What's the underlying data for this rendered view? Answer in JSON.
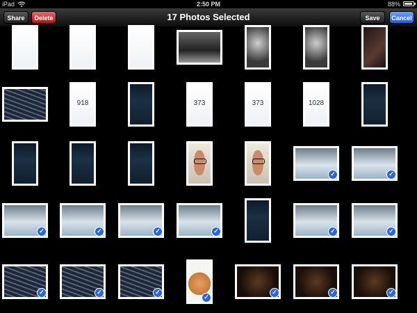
{
  "status": {
    "device": "iPad",
    "time": "2:50 PM",
    "battery": "88%",
    "battery_level": 0.88
  },
  "nav": {
    "share": "Share",
    "delete": "Delete",
    "title": "17 Photos Selected",
    "save": "Save",
    "cancel": "Cancel"
  },
  "photos": [
    {
      "kind": "screenshot-form",
      "sel": false
    },
    {
      "kind": "screenshot-profile",
      "sel": false
    },
    {
      "kind": "screenshot-web",
      "sel": false
    },
    {
      "kind": "photo-laptop",
      "sel": false
    },
    {
      "kind": "photo-glasses",
      "sel": false
    },
    {
      "kind": "photo-glasses",
      "sel": false
    },
    {
      "kind": "photo-dark",
      "sel": false
    },
    {
      "kind": "photo-keyboard",
      "sel": false
    },
    {
      "kind": "screenshot-number",
      "number": "918",
      "sel": false
    },
    {
      "kind": "screenshot-speed",
      "sel": false
    },
    {
      "kind": "screenshot-number",
      "number": "373",
      "sel": false
    },
    {
      "kind": "screenshot-number",
      "number": "373",
      "sel": false
    },
    {
      "kind": "screenshot-number",
      "number": "1028",
      "sel": false
    },
    {
      "kind": "screenshot-speed",
      "sel": false
    },
    {
      "kind": "screenshot-speed",
      "sel": false
    },
    {
      "kind": "screenshot-list",
      "sel": false
    },
    {
      "kind": "screenshot-list",
      "sel": false
    },
    {
      "kind": "photo-face",
      "sel": false
    },
    {
      "kind": "photo-face",
      "sel": false
    },
    {
      "kind": "photo-lego",
      "sel": true
    },
    {
      "kind": "photo-lego",
      "sel": true
    },
    {
      "kind": "photo-lego",
      "sel": true
    },
    {
      "kind": "photo-lego",
      "sel": true
    },
    {
      "kind": "photo-lego",
      "sel": true
    },
    {
      "kind": "photo-lego",
      "sel": true
    },
    {
      "kind": "screenshot-list",
      "sel": false
    },
    {
      "kind": "photo-lego",
      "sel": true
    },
    {
      "kind": "photo-lego",
      "sel": true
    },
    {
      "kind": "photo-keyboard",
      "sel": true
    },
    {
      "kind": "photo-keyboard",
      "sel": true
    },
    {
      "kind": "photo-keyboard",
      "sel": true
    },
    {
      "kind": "photo-hand",
      "sel": true
    },
    {
      "kind": "photo-earbuds",
      "sel": true
    },
    {
      "kind": "photo-earbuds",
      "sel": true
    },
    {
      "kind": "photo-earbuds",
      "sel": true
    }
  ]
}
